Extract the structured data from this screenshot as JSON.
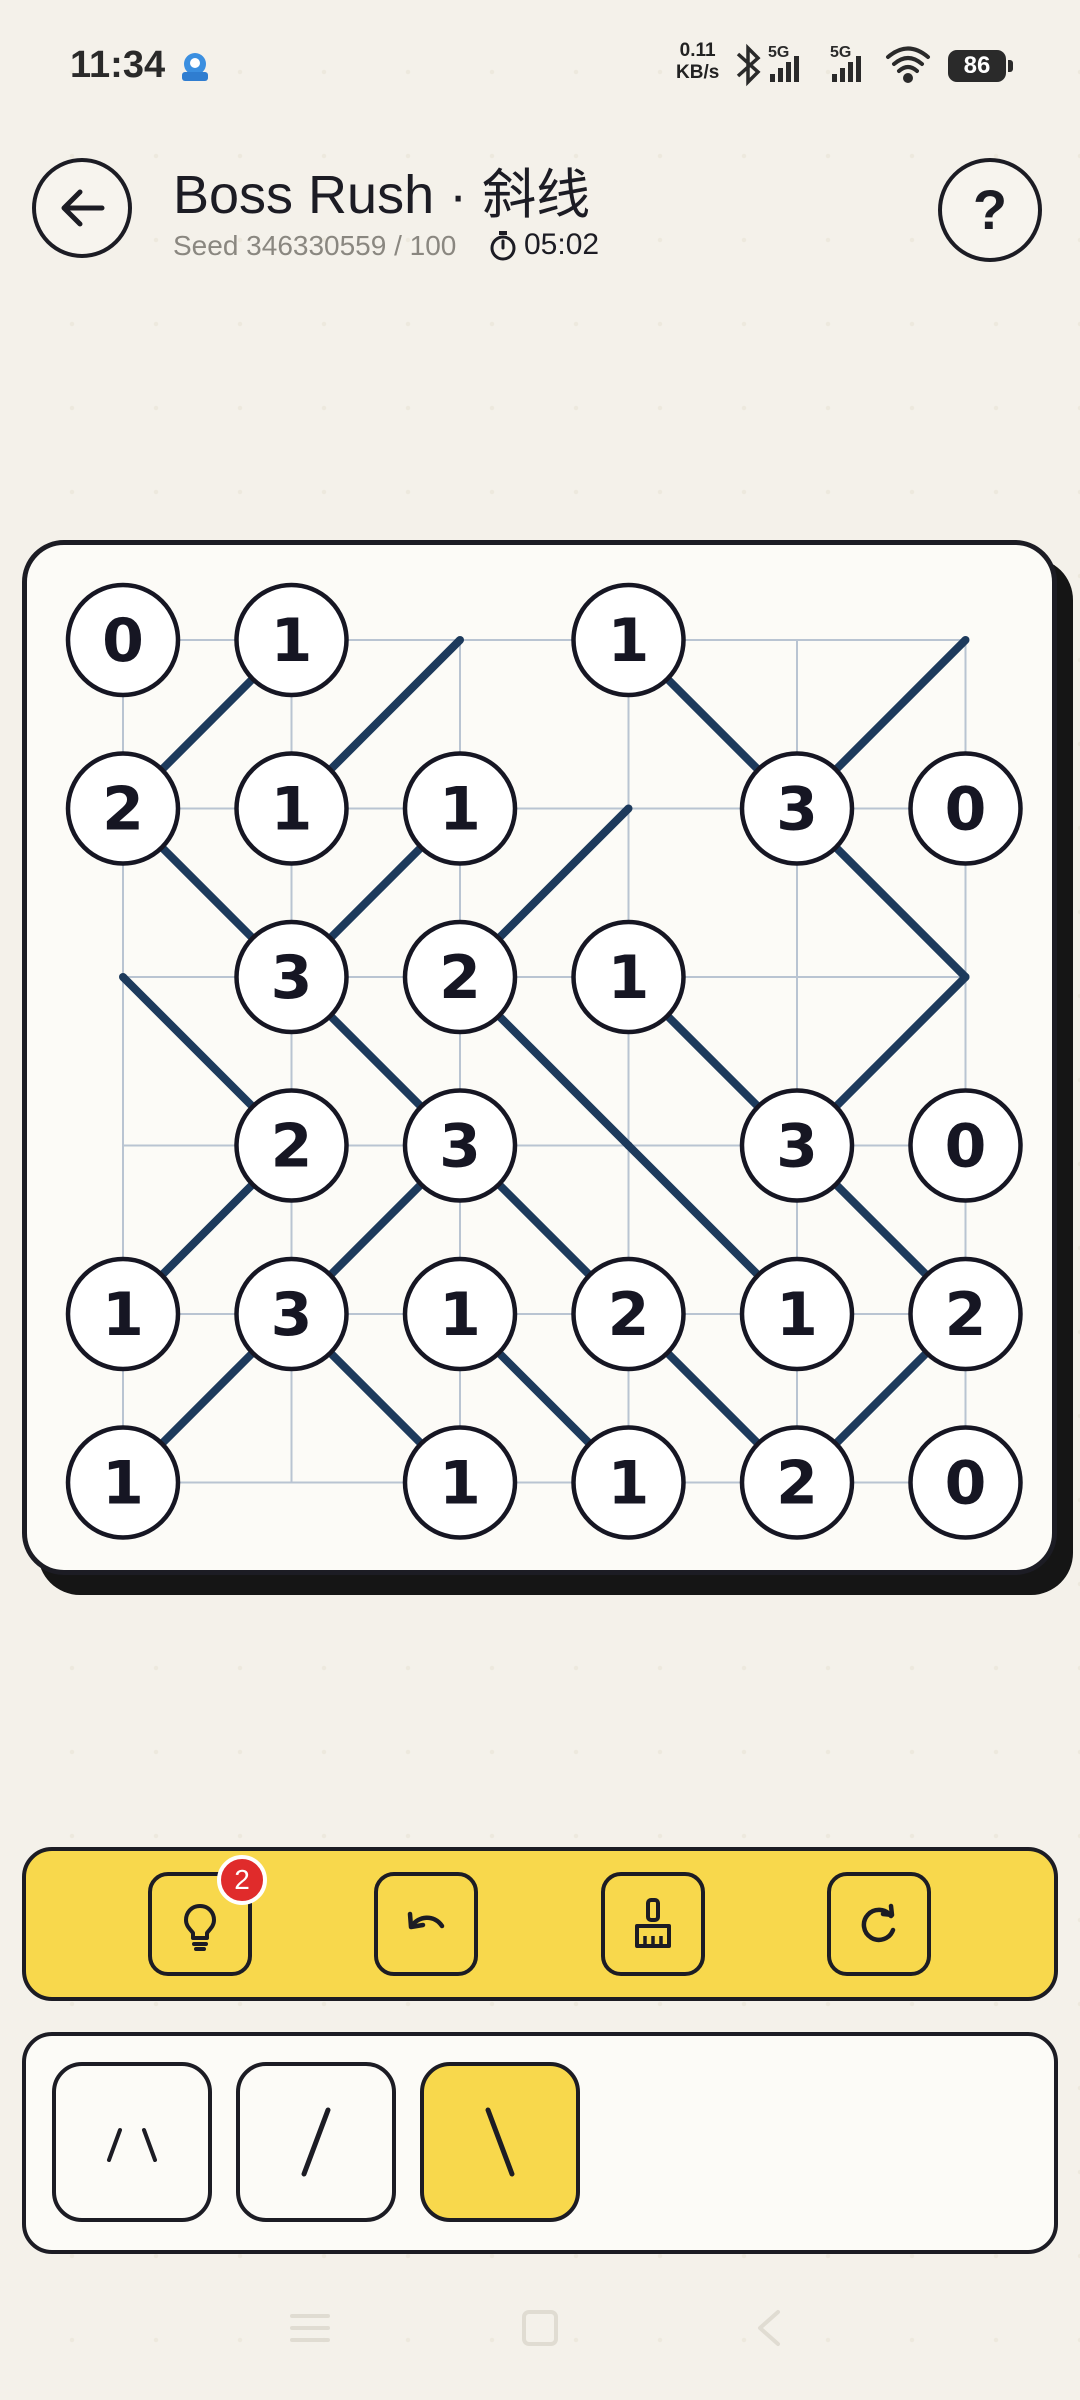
{
  "status_bar": {
    "time": "11:34",
    "net_speed_value": "0.11",
    "net_speed_unit": "KB/s",
    "battery": "86"
  },
  "header": {
    "title": "Boss Rush  ·  斜线",
    "seed": "Seed 346330559 / 100",
    "timer": "05:02",
    "help_label": "?"
  },
  "board": {
    "grid_cols": 6,
    "grid_rows": 6,
    "clues": [
      {
        "r": 0,
        "c": 0,
        "v": "0"
      },
      {
        "r": 0,
        "c": 1,
        "v": "1"
      },
      {
        "r": 0,
        "c": 3,
        "v": "1"
      },
      {
        "r": 1,
        "c": 0,
        "v": "2"
      },
      {
        "r": 1,
        "c": 1,
        "v": "1"
      },
      {
        "r": 1,
        "c": 2,
        "v": "1"
      },
      {
        "r": 1,
        "c": 4,
        "v": "3"
      },
      {
        "r": 1,
        "c": 5,
        "v": "0"
      },
      {
        "r": 2,
        "c": 1,
        "v": "3"
      },
      {
        "r": 2,
        "c": 2,
        "v": "2"
      },
      {
        "r": 2,
        "c": 3,
        "v": "1"
      },
      {
        "r": 3,
        "c": 1,
        "v": "2"
      },
      {
        "r": 3,
        "c": 2,
        "v": "3"
      },
      {
        "r": 3,
        "c": 4,
        "v": "3"
      },
      {
        "r": 3,
        "c": 5,
        "v": "0"
      },
      {
        "r": 4,
        "c": 0,
        "v": "1"
      },
      {
        "r": 4,
        "c": 1,
        "v": "3"
      },
      {
        "r": 4,
        "c": 2,
        "v": "1"
      },
      {
        "r": 4,
        "c": 3,
        "v": "2"
      },
      {
        "r": 4,
        "c": 4,
        "v": "1"
      },
      {
        "r": 4,
        "c": 5,
        "v": "2"
      },
      {
        "r": 5,
        "c": 0,
        "v": "1"
      },
      {
        "r": 5,
        "c": 2,
        "v": "1"
      },
      {
        "r": 5,
        "c": 3,
        "v": "1"
      },
      {
        "r": 5,
        "c": 4,
        "v": "2"
      },
      {
        "r": 5,
        "c": 5,
        "v": "0"
      }
    ],
    "diagonals": [
      {
        "r": 0,
        "c": 0,
        "d": "/"
      },
      {
        "r": 0,
        "c": 1,
        "d": "/"
      },
      {
        "r": 0,
        "c": 3,
        "d": "\\"
      },
      {
        "r": 0,
        "c": 4,
        "d": "/"
      },
      {
        "r": 1,
        "c": 0,
        "d": "\\"
      },
      {
        "r": 1,
        "c": 1,
        "d": "/"
      },
      {
        "r": 1,
        "c": 2,
        "d": "/"
      },
      {
        "r": 1,
        "c": 4,
        "d": "\\"
      },
      {
        "r": 2,
        "c": 0,
        "d": "\\"
      },
      {
        "r": 2,
        "c": 1,
        "d": "\\"
      },
      {
        "r": 2,
        "c": 2,
        "d": "\\"
      },
      {
        "r": 2,
        "c": 3,
        "d": "\\"
      },
      {
        "r": 2,
        "c": 4,
        "d": "/"
      },
      {
        "r": 3,
        "c": 0,
        "d": "/"
      },
      {
        "r": 3,
        "c": 1,
        "d": "/"
      },
      {
        "r": 3,
        "c": 2,
        "d": "\\"
      },
      {
        "r": 3,
        "c": 3,
        "d": "\\"
      },
      {
        "r": 3,
        "c": 4,
        "d": "\\"
      },
      {
        "r": 4,
        "c": 0,
        "d": "/"
      },
      {
        "r": 4,
        "c": 1,
        "d": "\\"
      },
      {
        "r": 4,
        "c": 2,
        "d": "\\"
      },
      {
        "r": 4,
        "c": 3,
        "d": "\\"
      },
      {
        "r": 4,
        "c": 4,
        "d": "/"
      }
    ]
  },
  "toolbar": {
    "tools": [
      {
        "icon": "hint-bulb-icon",
        "badge": "2"
      },
      {
        "icon": "undo-icon"
      },
      {
        "icon": "clear-brush-icon"
      },
      {
        "icon": "restart-icon"
      }
    ]
  },
  "selector": {
    "options": [
      {
        "name": "both-diagonals-option",
        "glyph": "/ \\",
        "selected": false
      },
      {
        "name": "forward-slash-option",
        "glyph": "/",
        "selected": false
      },
      {
        "name": "back-slash-option",
        "glyph": "\\",
        "selected": true
      }
    ]
  },
  "colors": {
    "accent_yellow": "#f8d84c",
    "line_navy": "#1d3a5c",
    "ink": "#1c1c24",
    "background": "#f4f1ea",
    "badge_red": "#e02b2b"
  }
}
